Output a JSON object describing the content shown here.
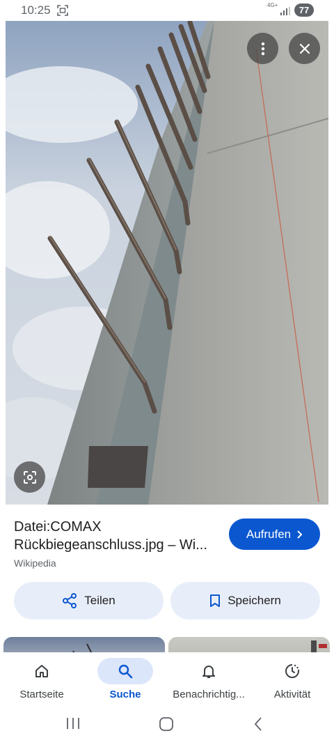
{
  "status_bar": {
    "time": "10:25",
    "network": "4G+",
    "battery": "77"
  },
  "viewer": {
    "image_alt": "Concrete wall with bent-back rebar connection",
    "more_icon": "more-vert-icon",
    "close_icon": "close-icon",
    "lens_icon": "lens-icon"
  },
  "result": {
    "title": "Datei:COMAX Rückbiegeanschluss.jpg – Wi...",
    "source": "Wikipedia",
    "visit_label": "Aufrufen",
    "visit_icon": "chevron-right-icon",
    "share_label": "Teilen",
    "save_label": "Speichern"
  },
  "bottom_nav": {
    "items": [
      {
        "label": "Startseite",
        "icon": "home-icon"
      },
      {
        "label": "Suche",
        "icon": "search-icon"
      },
      {
        "label": "Benachrichtig...",
        "icon": "bell-icon"
      },
      {
        "label": "Aktivität",
        "icon": "activity-icon"
      }
    ],
    "active": "Suche"
  },
  "colors": {
    "accent": "#0b57d0",
    "pill_bg": "#e8eef9",
    "active_nav_bg": "#dce6fa"
  }
}
